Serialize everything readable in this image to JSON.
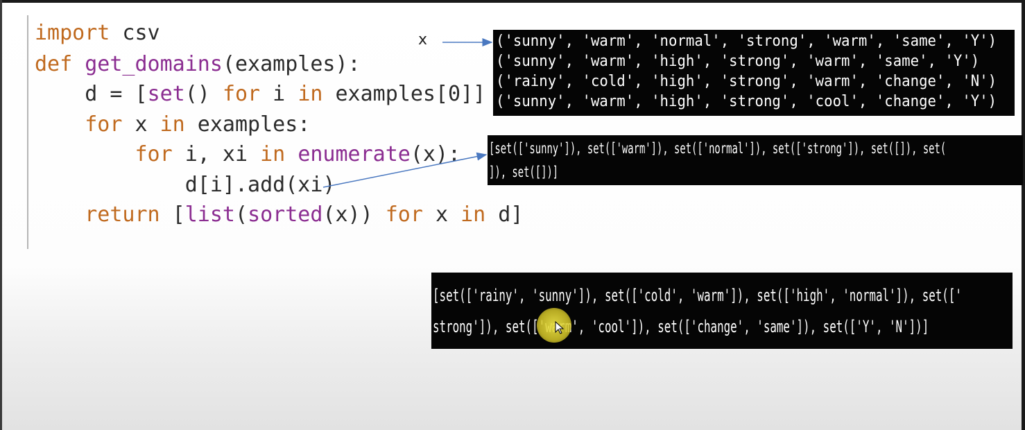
{
  "code": {
    "lines": [
      [
        {
          "t": "import",
          "c": "kw"
        },
        {
          "t": " csv",
          "c": ""
        }
      ],
      [
        {
          "t": "def",
          "c": "kw"
        },
        {
          "t": " ",
          "c": ""
        },
        {
          "t": "get_domains",
          "c": "bi"
        },
        {
          "t": "(examples):",
          "c": ""
        }
      ],
      [
        {
          "t": "    d = [",
          "c": ""
        },
        {
          "t": "set",
          "c": "bi"
        },
        {
          "t": "() ",
          "c": ""
        },
        {
          "t": "for",
          "c": "kw"
        },
        {
          "t": " i ",
          "c": ""
        },
        {
          "t": "in",
          "c": "kw"
        },
        {
          "t": " examples[0]]",
          "c": ""
        }
      ],
      [
        {
          "t": "    ",
          "c": ""
        },
        {
          "t": "for",
          "c": "kw"
        },
        {
          "t": " x ",
          "c": ""
        },
        {
          "t": "in",
          "c": "kw"
        },
        {
          "t": " examples:",
          "c": ""
        }
      ],
      [
        {
          "t": "        ",
          "c": ""
        },
        {
          "t": "for",
          "c": "kw"
        },
        {
          "t": " i, xi ",
          "c": ""
        },
        {
          "t": "in",
          "c": "kw"
        },
        {
          "t": " ",
          "c": ""
        },
        {
          "t": "enumerate",
          "c": "bi"
        },
        {
          "t": "(x):",
          "c": ""
        }
      ],
      [
        {
          "t": "            d[i].add(xi)",
          "c": ""
        }
      ],
      [
        {
          "t": "    ",
          "c": ""
        },
        {
          "t": "return",
          "c": "kw"
        },
        {
          "t": " [",
          "c": ""
        },
        {
          "t": "list",
          "c": "bi"
        },
        {
          "t": "(",
          "c": ""
        },
        {
          "t": "sorted",
          "c": "bi"
        },
        {
          "t": "(x)) ",
          "c": ""
        },
        {
          "t": "for",
          "c": "kw"
        },
        {
          "t": " x ",
          "c": ""
        },
        {
          "t": "in",
          "c": "kw"
        },
        {
          "t": " d]",
          "c": ""
        }
      ]
    ],
    "colors": {
      "keyword": "#c06a1f",
      "builtin": "#8b2d91",
      "text": "#2b2b2b"
    }
  },
  "annotation": {
    "x_label": "x"
  },
  "terminal_examples": {
    "lines": [
      "('sunny', 'warm', 'normal', 'strong', 'warm', 'same', 'Y')",
      "('sunny', 'warm', 'high', 'strong', 'warm', 'same', 'Y')",
      "('rainy', 'cold', 'high', 'strong', 'warm', 'change', 'N')",
      "('sunny', 'warm', 'high', 'strong', 'cool', 'change', 'Y')"
    ]
  },
  "terminal_domains_single": {
    "lines": [
      "[set(['sunny']), set(['warm']), set(['normal']), set(['strong']), set([]), set(",
      "]), set([])]"
    ]
  },
  "terminal_domains_all": {
    "lines": [
      "[set(['rainy', 'sunny']), set(['cold', 'warm']), set(['high', 'normal']), set(['",
      "strong']), set(['warm', 'cool']), set(['change', 'same']), set(['Y', 'N'])]"
    ]
  }
}
